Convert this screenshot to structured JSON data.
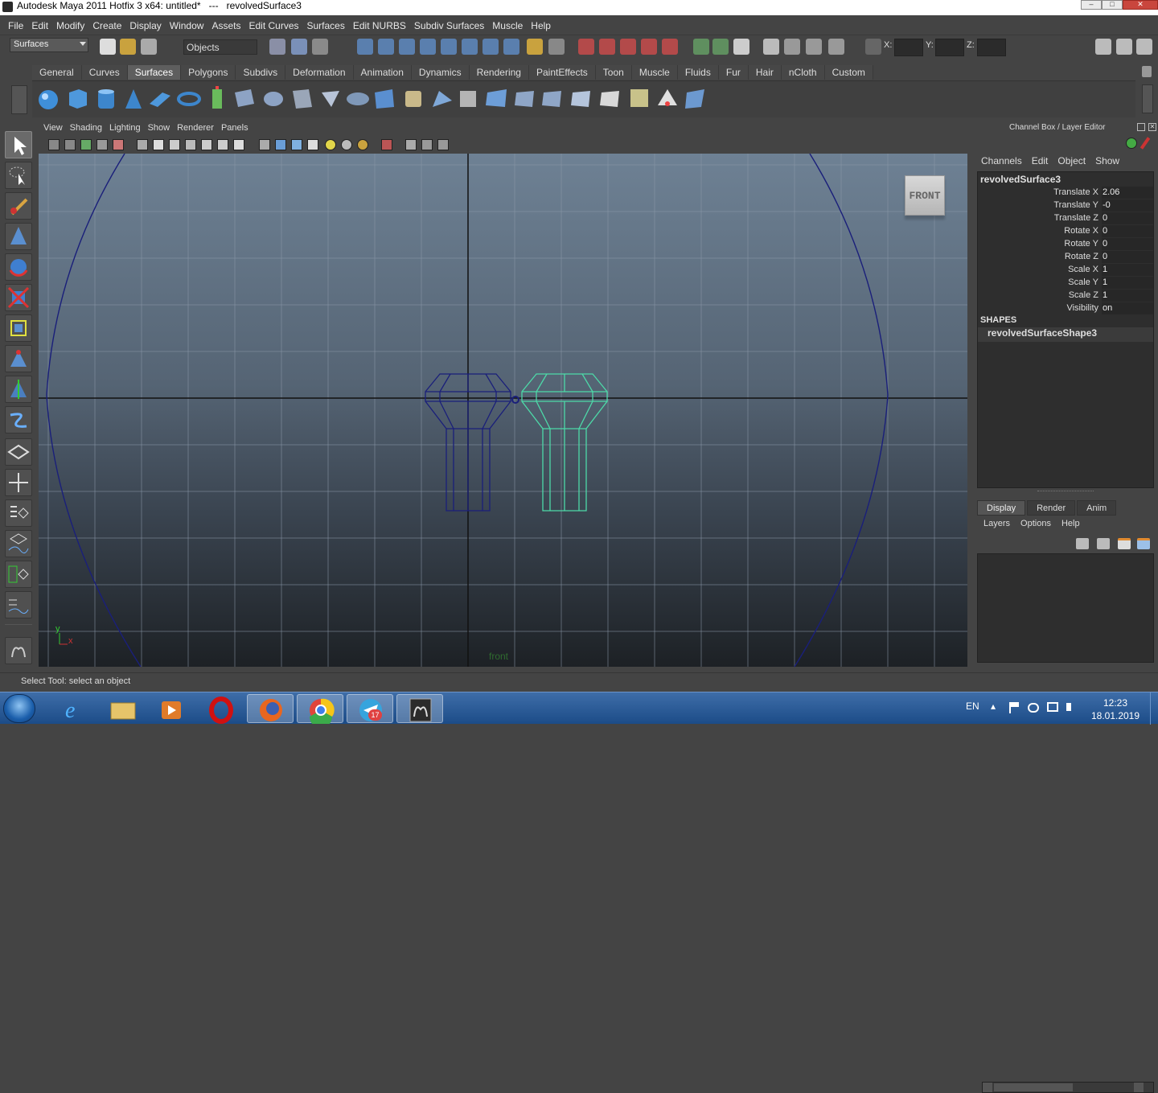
{
  "window": {
    "title": "Autodesk Maya 2011 Hotfix 3 x64: untitled*   ---   revolvedSurface3"
  },
  "menubar": [
    "File",
    "Edit",
    "Modify",
    "Create",
    "Display",
    "Window",
    "Assets",
    "Edit Curves",
    "Surfaces",
    "Edit NURBS",
    "Subdiv Surfaces",
    "Muscle",
    "Help"
  ],
  "statusline": {
    "mode": "Surfaces",
    "selection_field": "Objects",
    "x_label": "X:",
    "y_label": "Y:",
    "z_label": "Z:"
  },
  "shelf_tabs": [
    "General",
    "Curves",
    "Surfaces",
    "Polygons",
    "Subdivs",
    "Deformation",
    "Animation",
    "Dynamics",
    "Rendering",
    "PaintEffects",
    "Toon",
    "Muscle",
    "Fluids",
    "Fur",
    "Hair",
    "nCloth",
    "Custom"
  ],
  "shelf_active": "Surfaces",
  "panel_menu": [
    "View",
    "Shading",
    "Lighting",
    "Show",
    "Renderer",
    "Panels"
  ],
  "viewport": {
    "view_cube": "FRONT",
    "camera": "front",
    "axis_y": "y",
    "axis_x": "x"
  },
  "channel_box": {
    "header": "Channel Box / Layer Editor",
    "menu": [
      "Channels",
      "Edit",
      "Object",
      "Show"
    ],
    "object": "revolvedSurface3",
    "channels": [
      {
        "label": "Translate X",
        "value": "2.06"
      },
      {
        "label": "Translate Y",
        "value": "-0"
      },
      {
        "label": "Translate Z",
        "value": "0"
      },
      {
        "label": "Rotate X",
        "value": "0"
      },
      {
        "label": "Rotate Y",
        "value": "0"
      },
      {
        "label": "Rotate Z",
        "value": "0"
      },
      {
        "label": "Scale X",
        "value": "1"
      },
      {
        "label": "Scale Y",
        "value": "1"
      },
      {
        "label": "Scale Z",
        "value": "1"
      },
      {
        "label": "Visibility",
        "value": "on"
      }
    ],
    "shapes_label": "SHAPES",
    "shape_name": "revolvedSurfaceShape3"
  },
  "layer_editor": {
    "tabs": [
      "Display",
      "Render",
      "Anim"
    ],
    "menu": [
      "Layers",
      "Options",
      "Help"
    ]
  },
  "help_line": "Select Tool: select an object",
  "taskbar": {
    "lang": "EN",
    "time": "12:23",
    "date": "18.01.2019",
    "badge": "17"
  },
  "colors": {
    "selected_wire": "#4dd9a8",
    "unselected_wire": "#1a1f7a",
    "viewport_top": "#6e8194"
  }
}
